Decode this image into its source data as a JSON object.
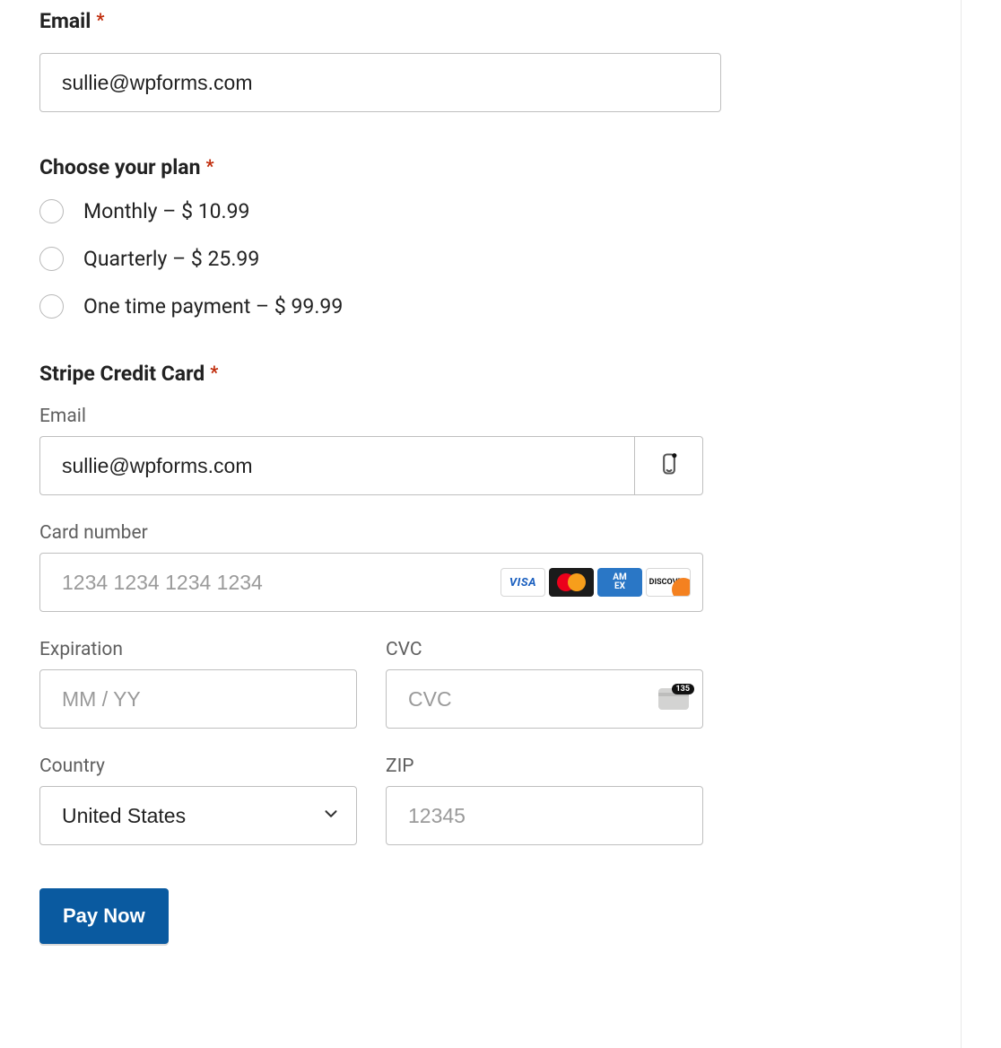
{
  "email": {
    "label": "Email",
    "value": "sullie@wpforms.com"
  },
  "plan": {
    "label": "Choose your plan",
    "options": [
      "Monthly – $ 10.99",
      "Quarterly – $ 25.99",
      "One time payment – $ 99.99"
    ]
  },
  "stripe": {
    "section_label": "Stripe Credit Card",
    "email_label": "Email",
    "email_value": "sullie@wpforms.com",
    "card_label": "Card number",
    "card_placeholder": "1234 1234 1234 1234",
    "exp_label": "Expiration",
    "exp_placeholder": "MM / YY",
    "cvc_label": "CVC",
    "cvc_placeholder": "CVC",
    "cvc_badge_text": "135",
    "country_label": "Country",
    "country_value": "United States",
    "zip_label": "ZIP",
    "zip_placeholder": "12345",
    "brands": {
      "visa": "VISA",
      "amex": "AM\nEX",
      "discover": "DISCOVER"
    }
  },
  "submit": {
    "label": "Pay Now"
  },
  "colors": {
    "primary": "#0a5aa0",
    "required": "#c02b0a"
  }
}
